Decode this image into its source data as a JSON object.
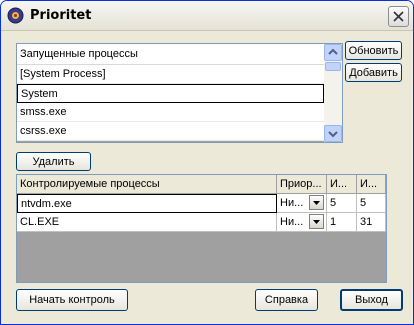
{
  "window": {
    "title": "Prioritet"
  },
  "buttons": {
    "refresh": "Обновить",
    "add": "Добавить",
    "remove": "Удалить",
    "start": "Начать контроль",
    "help": "Справка",
    "exit": "Выход"
  },
  "running": {
    "header": "Запущенные процессы",
    "items": [
      "[System Process]",
      "System",
      "smss.exe",
      "csrss.exe"
    ],
    "selected_index": 1
  },
  "monitored": {
    "columns": [
      "Контролируемые процессы",
      "Приор...",
      "И...",
      "И..."
    ],
    "rows": [
      {
        "name": "ntvdm.exe",
        "priority": "Ни...",
        "a": "5",
        "b": "5"
      },
      {
        "name": "CL.EXE",
        "priority": "Ни...",
        "a": "1",
        "b": "31"
      }
    ]
  },
  "icons": {
    "app": "app-icon",
    "close": "close-icon",
    "scroll_up": "arrow-up-icon",
    "scroll_down": "arrow-down-icon",
    "combo": "chevron-down-icon"
  }
}
